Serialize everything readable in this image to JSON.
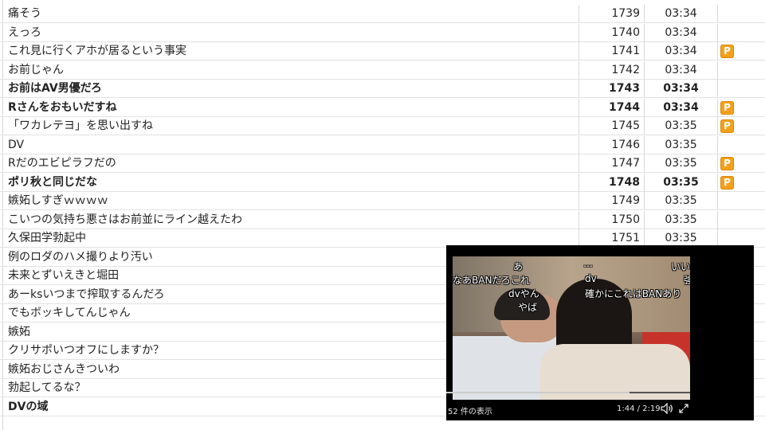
{
  "comments": [
    {
      "text": "痛そう",
      "no": "1739",
      "time": "03:34",
      "bold": false,
      "premium": false
    },
    {
      "text": "えっろ",
      "no": "1740",
      "time": "03:34",
      "bold": false,
      "premium": false
    },
    {
      "text": "これ見に行くアホが居るという事実",
      "no": "1741",
      "time": "03:34",
      "bold": false,
      "premium": true
    },
    {
      "text": "お前じゃん",
      "no": "1742",
      "time": "03:34",
      "bold": false,
      "premium": false
    },
    {
      "text": "お前はAV男優だろ",
      "no": "1743",
      "time": "03:34",
      "bold": true,
      "premium": false
    },
    {
      "text": "Rさんをおもいだすね",
      "no": "1744",
      "time": "03:34",
      "bold": true,
      "premium": true
    },
    {
      "text": "「ワカレテヨ」を思い出すね",
      "no": "1745",
      "time": "03:35",
      "bold": false,
      "premium": true
    },
    {
      "text": "DV",
      "no": "1746",
      "time": "03:35",
      "bold": false,
      "premium": false
    },
    {
      "text": "Rだのエビピラフだの",
      "no": "1747",
      "time": "03:35",
      "bold": false,
      "premium": true
    },
    {
      "text": "ポリ秋と同じだな",
      "no": "1748",
      "time": "03:35",
      "bold": true,
      "premium": true
    },
    {
      "text": "嫉妬しすぎｗｗｗｗ",
      "no": "1749",
      "time": "03:35",
      "bold": false,
      "premium": false
    },
    {
      "text": "こいつの気持ち悪さはお前並にライン越えたわ",
      "no": "1750",
      "time": "03:35",
      "bold": false,
      "premium": false
    },
    {
      "text": "久保田学勃起中",
      "no": "1751",
      "time": "03:35",
      "bold": false,
      "premium": false
    },
    {
      "text": "例のロダのハメ撮りより汚い",
      "no": "",
      "time": "",
      "bold": false,
      "premium": false
    },
    {
      "text": "未来とずいえきと堀田",
      "no": "",
      "time": "",
      "bold": false,
      "premium": false
    },
    {
      "text": "あーksいつまで搾取するんだろ",
      "no": "",
      "time": "",
      "bold": false,
      "premium": false
    },
    {
      "text": "でもボッキしてんじゃん",
      "no": "",
      "time": "",
      "bold": false,
      "premium": false
    },
    {
      "text": "嫉妬",
      "no": "",
      "time": "",
      "bold": false,
      "premium": false
    },
    {
      "text": "クリサポいつオフにしますか？",
      "no": "",
      "time": "",
      "bold": false,
      "premium": false
    },
    {
      "text": "嫉妬おじさんきついわ",
      "no": "",
      "time": "",
      "bold": false,
      "premium": false
    },
    {
      "text": "勃起してるな？",
      "no": "",
      "time": "",
      "bold": false,
      "premium": false
    },
    {
      "text": "DVの域",
      "no": "",
      "time": "",
      "bold": true,
      "premium": false
    }
  ],
  "premium_badge": "P",
  "colors": {
    "premium_badge": "#f5a01a",
    "row_border": "#e2e2e2"
  },
  "player": {
    "danmaku": [
      "あ",
      "…",
      "いい",
      "なあBANだろこれ",
      "dv",
      "強",
      "dvやん",
      "確かにこれはBANあり",
      "やば"
    ],
    "comment_count": "52 件の表示",
    "time": "1:44 / 2:19",
    "progress": 0.75,
    "icons": [
      "volume-icon",
      "fullscreen-icon"
    ]
  }
}
